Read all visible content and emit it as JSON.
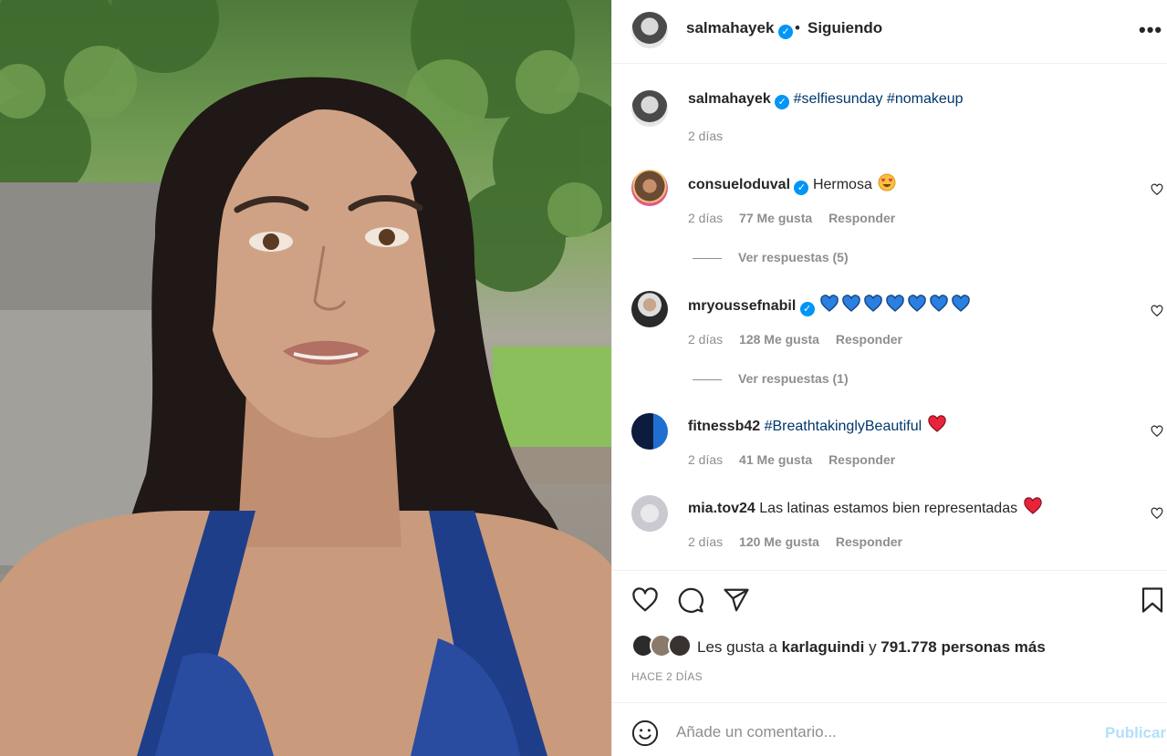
{
  "post": {
    "author": "salmahayek",
    "separator": "•",
    "follow_status": "Siguiendo",
    "more_icon": "more-horizontal-icon"
  },
  "caption": {
    "user": "salmahayek",
    "hashtags": "#selfiesunday #nomakeup",
    "time": "2 días"
  },
  "comments": [
    {
      "user": "consueloduval",
      "verified": true,
      "text": "Hermosa",
      "emoji": "heart-eyes-emoji",
      "time": "2 días",
      "likes": "77 Me gusta",
      "reply_label": "Responder",
      "view_replies": "Ver respuestas (5)"
    },
    {
      "user": "mryoussefnabil",
      "verified": true,
      "text": "",
      "emoji": "blue-hearts-emoji",
      "time": "2 días",
      "likes": "128 Me gusta",
      "reply_label": "Responder",
      "view_replies": "Ver respuestas (1)"
    },
    {
      "user": "fitnessb42",
      "verified": false,
      "text": "#BreathtakinglyBeautiful",
      "emoji": "red-heart-emoji",
      "time": "2 días",
      "likes": "41 Me gusta",
      "reply_label": "Responder"
    },
    {
      "user": "mia.tov24",
      "verified": false,
      "text": "Las latinas estamos bien representadas",
      "emoji": "red-heart-emoji",
      "time": "2 días",
      "likes": "120 Me gusta",
      "reply_label": "Responder"
    }
  ],
  "likes": {
    "prefix": "Les gusta a",
    "user": "karlaguindi",
    "middle": "y",
    "count": "791.778 personas más"
  },
  "time_ago": "HACE 2 DÍAS",
  "comment_box": {
    "placeholder": "Añade un comentario...",
    "publish": "Publicar"
  },
  "colors": {
    "verified": "#0095f6",
    "hashtag": "#00376b",
    "muted": "#8e8e8e",
    "publish": "#b2dffc"
  }
}
